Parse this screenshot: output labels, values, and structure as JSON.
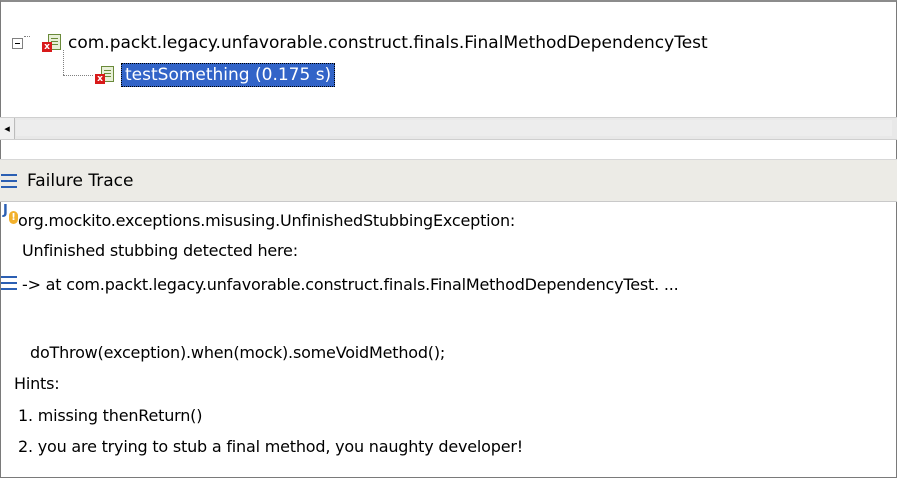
{
  "tree": {
    "suite_label": "com.packt.legacy.unfavorable.construct.finals.FinalMethodDependencyTest",
    "test_label": "testSomething (0.175 s)",
    "toggle_glyph": "−"
  },
  "scrollbar": {
    "left_arrow": "◂"
  },
  "failure_trace": {
    "header": "Failure Trace",
    "lines": [
      "org.mockito.exceptions.misusing.UnfinishedStubbingException:",
      "Unfinished stubbing detected here:",
      "-> at com.packt.legacy.unfavorable.construct.finals.FinalMethodDependencyTest. ...",
      "doThrow(exception).when(mock).someVoidMethod();",
      "Hints:",
      "1. missing thenReturn()",
      "2. you are trying to stub a final method, you naughty developer!"
    ]
  },
  "icons": {
    "error_mark": "x",
    "junit_letter": "J",
    "warning_mark": "!"
  },
  "colors": {
    "selection": "#3264c8",
    "error": "#d81a1a",
    "accent": "#2b5fb3",
    "header_bg": "#ecebe6"
  }
}
